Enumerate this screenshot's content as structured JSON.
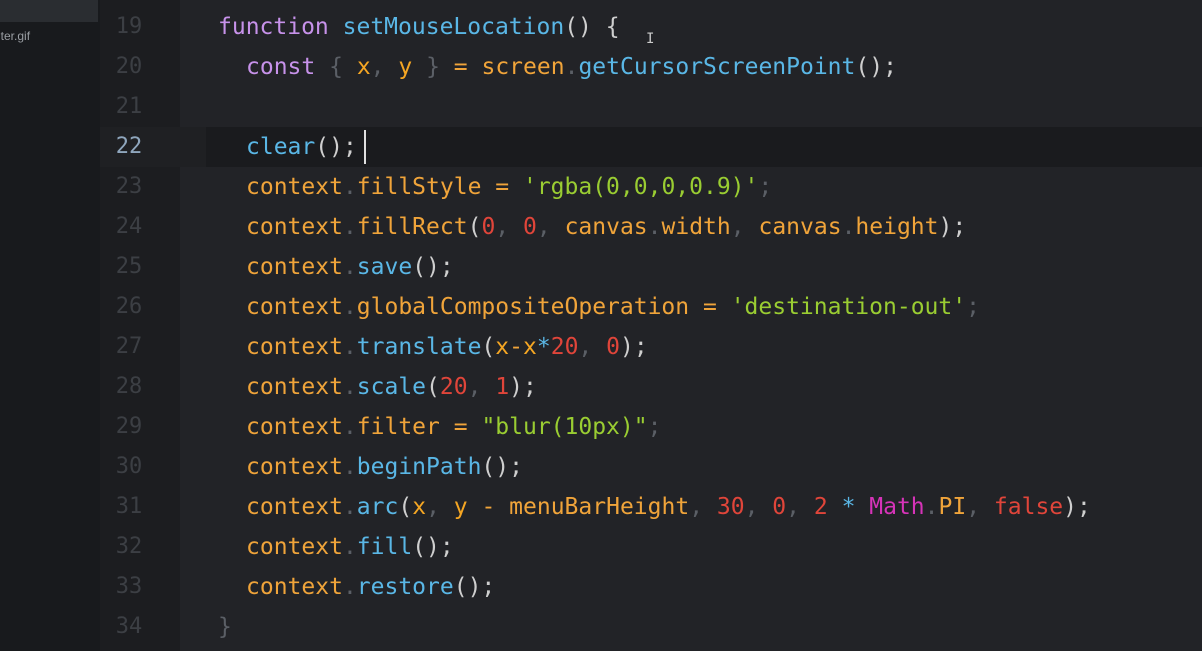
{
  "sidebar": {
    "file_label": "nter.gif"
  },
  "editor": {
    "current_line": 22,
    "lines": [
      {
        "n": "19"
      },
      {
        "n": "20"
      },
      {
        "n": "21"
      },
      {
        "n": "22"
      },
      {
        "n": "23"
      },
      {
        "n": "24"
      },
      {
        "n": "25"
      },
      {
        "n": "26"
      },
      {
        "n": "27"
      },
      {
        "n": "28"
      },
      {
        "n": "29"
      },
      {
        "n": "30"
      },
      {
        "n": "31"
      },
      {
        "n": "32"
      },
      {
        "n": "33"
      },
      {
        "n": "34"
      }
    ],
    "code": {
      "l19": {
        "kw": "function",
        "name": "setMouseLocation",
        "rest": "() {"
      },
      "l20": {
        "kw": "const",
        "open": "{ ",
        "x": "x",
        "comma": ", ",
        "y": "y",
        "close": " }",
        "eq": " = ",
        "obj": "screen",
        "dot": ".",
        "method": "getCursorScreenPoint",
        "tail": "();"
      },
      "l22": {
        "fn": "clear",
        "tail": "();"
      },
      "l23": {
        "obj": "context",
        "dot": ".",
        "prop": "fillStyle",
        "eq": " = ",
        "str": "'rgba(0,0,0,0.9)'",
        "semi": ";"
      },
      "l24": {
        "obj": "context",
        "dot": ".",
        "prop": "fillRect",
        "open": "(",
        "a1": "0",
        "c1": ", ",
        "a2": "0",
        "c2": ", ",
        "a3obj": "canvas",
        "a3dot": ".",
        "a3prop": "width",
        "c3": ", ",
        "a4obj": "canvas",
        "a4dot": ".",
        "a4prop": "height",
        "close": ");"
      },
      "l25": {
        "obj": "context",
        "dot": ".",
        "prop": "save",
        "tail": "();"
      },
      "l26": {
        "obj": "context",
        "dot": ".",
        "prop": "globalCompositeOperation",
        "eq": " = ",
        "str": "'destination-out'",
        "semi": ";"
      },
      "l27": {
        "obj": "context",
        "dot": ".",
        "prop": "translate",
        "open": "(",
        "a": "x",
        "minus": "-",
        "b": "x",
        "mul": "*",
        "n1": "20",
        "c": ", ",
        "n2": "0",
        "close": ");"
      },
      "l28": {
        "obj": "context",
        "dot": ".",
        "prop": "scale",
        "open": "(",
        "n1": "20",
        "c": ", ",
        "n2": "1",
        "close": ");"
      },
      "l29": {
        "obj": "context",
        "dot": ".",
        "prop": "filter",
        "eq": " = ",
        "str": "\"blur(10px)\"",
        "semi": ";"
      },
      "l30": {
        "obj": "context",
        "dot": ".",
        "prop": "beginPath",
        "tail": "();"
      },
      "l31": {
        "obj": "context",
        "dot": ".",
        "prop": "arc",
        "open": "(",
        "a": "x",
        "c1": ", ",
        "b": "y",
        "minus": " - ",
        "id": "menuBarHeight",
        "c2": ", ",
        "n1": "30",
        "c3": ", ",
        "n2": "0",
        "c4": ", ",
        "n3": "2",
        "mul": " * ",
        "math": "Math",
        "mdot": ".",
        "pi": "PI",
        "c5": ", ",
        "bool": "false",
        "close": ");"
      },
      "l32": {
        "obj": "context",
        "dot": ".",
        "prop": "fill",
        "tail": "();"
      },
      "l33": {
        "obj": "context",
        "dot": ".",
        "prop": "restore",
        "tail": "();"
      },
      "l34": {
        "close": "}"
      }
    }
  },
  "colors": {
    "background": "#222327",
    "keyword": "#c792ea",
    "function": "#5ab7e6",
    "variable": "#f5a623",
    "number": "#e0453a",
    "string": "#9acd32",
    "math": "#d633b8"
  }
}
